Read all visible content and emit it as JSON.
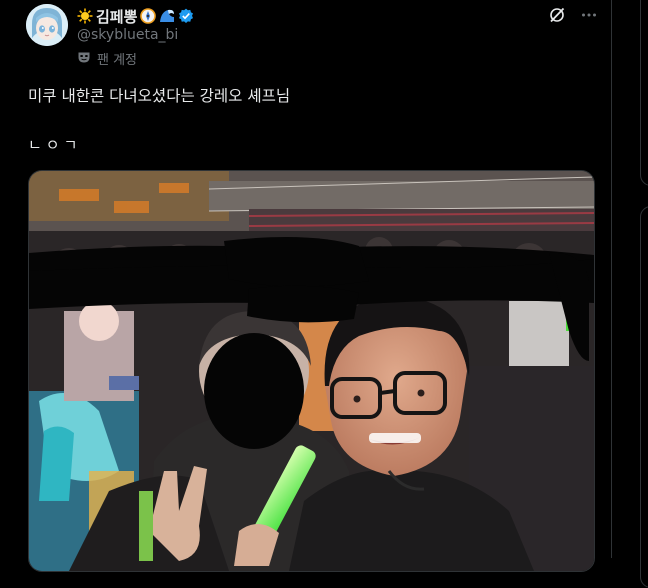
{
  "tweet": {
    "display_name": "김페뽕",
    "handle": "@skyblueta_bi",
    "fan_label": "팬 계정",
    "text_line1": "미쿠 내한콘 다녀오셨다는 강레오 셰프님",
    "text_line2": "ㄴㅇㄱ",
    "icons": {
      "avatar": "avatar-anime-character",
      "name_emoji_1": "sun-emoji",
      "name_emoji_2": "compass-badge-emoji",
      "name_emoji_3": "wave-emoji",
      "verified": "verified-badge-icon",
      "fan_icon": "mask-icon",
      "grok": "grok-icon",
      "more": "more-icon"
    },
    "colors": {
      "verified": "#1d9bf0",
      "secondary_text": "#71767b",
      "background": "#000000"
    }
  }
}
